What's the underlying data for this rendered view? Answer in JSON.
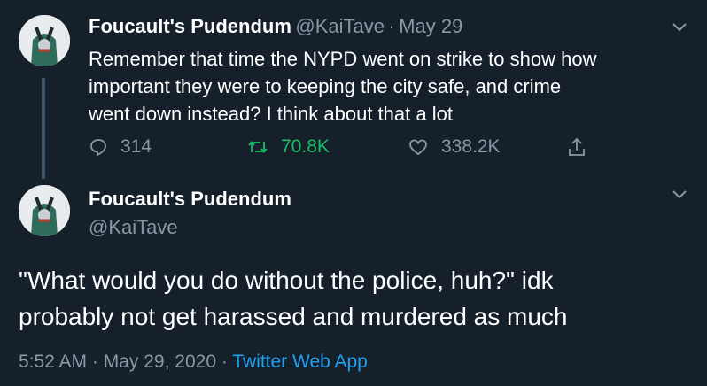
{
  "first_tweet": {
    "display_name": "Foucault's Pudendum",
    "handle": "@KaiTave",
    "separator": "·",
    "date": "May 29",
    "text_lines": [
      "Remember that time the NYPD went on strike to show how",
      "important they were to keeping the city safe, and crime",
      "went down instead? I think about that a lot"
    ],
    "replies": "314",
    "retweets": "70.8K",
    "likes": "338.2K"
  },
  "second_tweet": {
    "display_name": "Foucault's Pudendum",
    "handle": "@KaiTave",
    "text_lines": [
      "\"What would you do without the police, huh?\" idk",
      "probably not get harassed and murdered as much"
    ],
    "time": "5:52 AM",
    "separator": "·",
    "date": "May 29, 2020",
    "source": "Twitter Web App"
  },
  "colors": {
    "background": "#15202b",
    "secondary_text": "#8899a6",
    "retweet_green": "#17bf63",
    "link_blue": "#1da1f2"
  },
  "icons": [
    "chevron-down-icon",
    "reply-icon",
    "retweet-icon",
    "like-icon",
    "share-icon"
  ]
}
